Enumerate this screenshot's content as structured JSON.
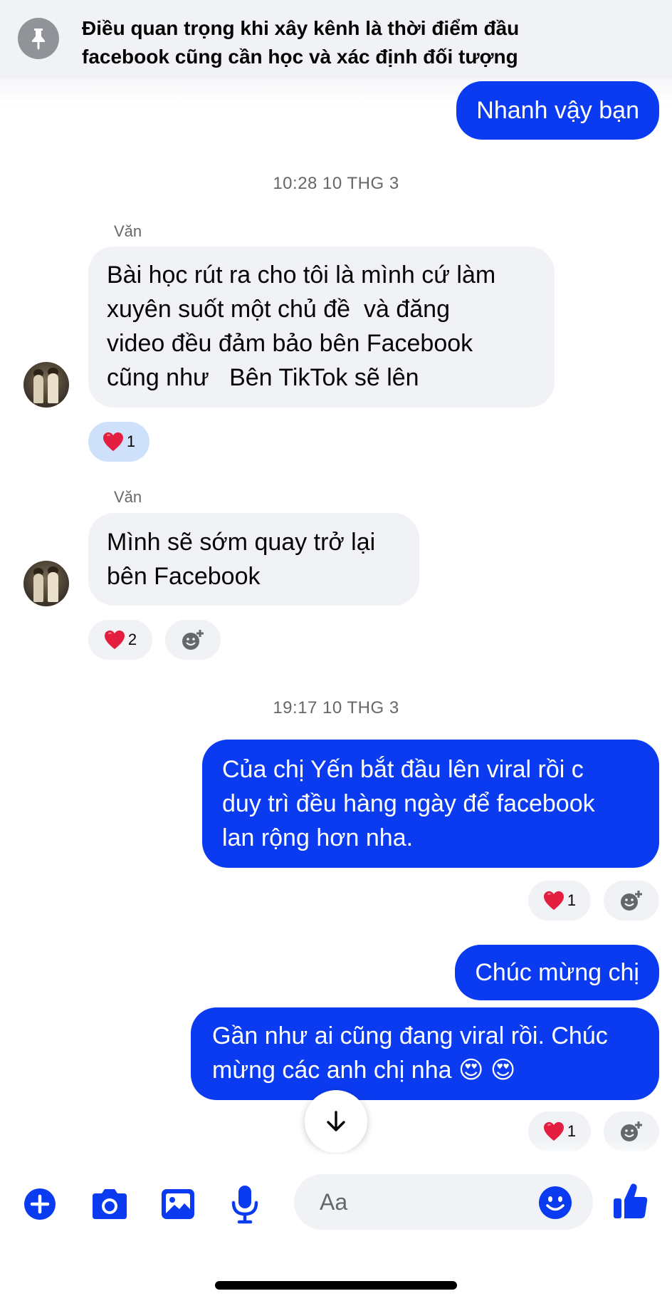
{
  "pinned": {
    "line1": "Điều quan trọng khi xây kênh là thời điểm đầu",
    "line2": "facebook cũng cần học và xác định đối tượng",
    "icon": "pin-icon"
  },
  "messages": {
    "out_top": "Nhanh vậy bạn",
    "timestamp1": "10:28 10 THG 3",
    "sender1": "Văn",
    "in1": [
      "Bài học rút ra cho tôi là mình cứ làm",
      "xuyên suốt một chủ đề  và đăng",
      "video đều đảm bảo bên Facebook",
      "cũng như   Bên TikTok sẽ lên"
    ],
    "in1_reaction_count": "1",
    "sender2": "Văn",
    "in2": [
      "Mình sẽ sớm quay trở lại",
      "bên Facebook"
    ],
    "in2_reaction_count": "2",
    "timestamp2": "19:17 10 THG 3",
    "out1": [
      "Của chị Yến bắt đầu lên viral rồi c",
      "duy trì đều hàng ngày để facebook",
      "lan rộng hơn nha."
    ],
    "out1_reaction_count": "1",
    "out2": "Chúc mừng chị",
    "out3": [
      "Gần như ai cũng đang viral rồi. Chúc",
      "mừng các anh chị nha 😍 😍"
    ],
    "out3_reaction_count": "1"
  },
  "composer": {
    "placeholder": "Aa",
    "icons": [
      "plus-icon",
      "camera-icon",
      "image-icon",
      "microphone-icon",
      "emoji-icon",
      "thumbs-up-icon"
    ]
  },
  "colors": {
    "accent": "#0a3bf0",
    "incoming_bubble": "#f0f2f5",
    "secondary_text": "#65676b",
    "heart": "#e41e3f"
  }
}
